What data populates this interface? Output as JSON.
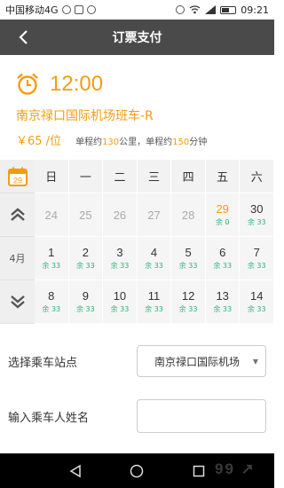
{
  "status_bar": {
    "carrier": "中国移动4G",
    "time": "09:21"
  },
  "header": {
    "title": "订票支付"
  },
  "trip": {
    "time": "12:00",
    "route": "南京禄口国际机场班车-R",
    "price": "￥65 /位",
    "distance_prefix": "单程约",
    "distance": "130",
    "distance_unit": "公里，",
    "duration_prefix": "单程约",
    "duration": "150",
    "duration_unit": "分钟"
  },
  "calendar": {
    "icon_day": "29",
    "month_label": "4月",
    "weekdays": [
      "日",
      "一",
      "二",
      "三",
      "四",
      "五",
      "六"
    ],
    "week1": [
      {
        "day": "24",
        "rem": ""
      },
      {
        "day": "25",
        "rem": ""
      },
      {
        "day": "26",
        "rem": ""
      },
      {
        "day": "27",
        "rem": ""
      },
      {
        "day": "28",
        "rem": ""
      },
      {
        "day": "29",
        "rem": "余 0"
      },
      {
        "day": "30",
        "rem": "余 33"
      }
    ],
    "week2": [
      {
        "day": "1",
        "rem": "余 33"
      },
      {
        "day": "2",
        "rem": "余 33"
      },
      {
        "day": "3",
        "rem": "余 33"
      },
      {
        "day": "4",
        "rem": "余 33"
      },
      {
        "day": "5",
        "rem": "余 33"
      },
      {
        "day": "6",
        "rem": "余 33"
      },
      {
        "day": "7",
        "rem": "余 33"
      }
    ],
    "week3": [
      {
        "day": "8",
        "rem": "余 33"
      },
      {
        "day": "9",
        "rem": "余 33"
      },
      {
        "day": "10",
        "rem": "余 33"
      },
      {
        "day": "11",
        "rem": "余 33"
      },
      {
        "day": "12",
        "rem": "余 33"
      },
      {
        "day": "13",
        "rem": "余 33"
      },
      {
        "day": "14",
        "rem": "余 33"
      }
    ]
  },
  "form": {
    "station_label": "选择乘车站点",
    "station_value": "南京禄口国际机场",
    "name_label": "输入乘车人姓名",
    "name_value": ""
  },
  "colors": {
    "accent": "#f39c12",
    "remaining": "#2ab37c",
    "navbar": "#4a4a4a"
  }
}
